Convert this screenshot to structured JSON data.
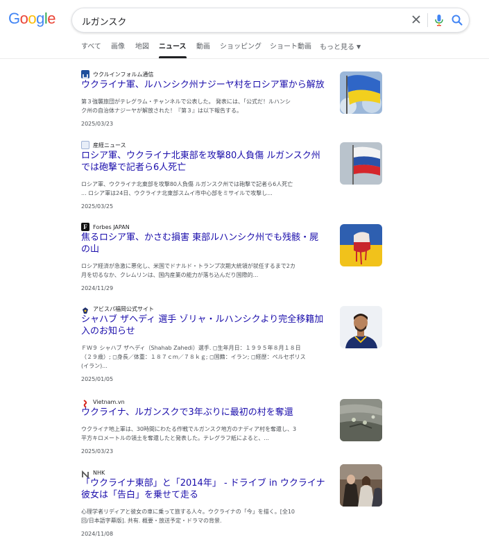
{
  "logo": {
    "text": "Google"
  },
  "search": {
    "query": "ルガンスク"
  },
  "tabs": [
    {
      "label": "すべて"
    },
    {
      "label": "画像"
    },
    {
      "label": "地図"
    },
    {
      "label": "ニュース"
    },
    {
      "label": "動画"
    },
    {
      "label": "ショッピング"
    },
    {
      "label": "ショート動画"
    },
    {
      "label": "もっと見る"
    }
  ],
  "results": [
    {
      "source": "ウクルインフォルム通信",
      "title_line1": "ウクライナ軍、ルハンシク州ナジーヤ村をロシア軍から解放",
      "title_line2": "",
      "snippet_line1": "第３強襲旅団がテレグラム・チャンネルで公表した。 発表には、「公式だ！ルハンシ",
      "snippet_line2": "ク州の自治体ナジーヤが解放された！『第３』は以下報告する。",
      "snippet_line3": "",
      "date": "2025/03/23"
    },
    {
      "source": "産経ニュース",
      "title_line1": "ロシア軍、ウクライナ北東部を攻撃80人負傷 ルガンスク州",
      "title_line2": "では砲撃で記者ら6人死亡",
      "snippet_line1": "ロシア軍、ウクライナ北東部を攻撃80人負傷 ルガンスク州では砲撃で記者ら6人死亡",
      "snippet_line2": "... ロシア軍は24日、ウクライナ北東部スムイ市中心部をミサイルで攻撃し...",
      "snippet_line3": "",
      "date": "2025/03/25"
    },
    {
      "source": "Forbes JAPAN",
      "title_line1": "焦るロシア軍、かさむ損害 東部ルハンシク州でも残骸・屍",
      "title_line2": "の山",
      "snippet_line1": "ロシア経済が急激に悪化し、米国でドナルド・トランプ次期大統領が就任するまで2カ",
      "snippet_line2": "月を切るなか、クレムリンは、国内産業の能力が落ち込んだり国際的...",
      "snippet_line3": "",
      "date": "2024/11/29"
    },
    {
      "source": "アビスパ福岡公式サイト",
      "title_line1": "シャハブ ザヘディ 選手 ゾリャ・ルハンシクより完全移籍加",
      "title_line2": "入のお知らせ",
      "snippet_line1": "ＦＷ９ シャハブ ザヘディ（Shahab Zahedi）選手. ◻生年月日：１９９５年８月１８日",
      "snippet_line2": "（２９歳）; ◻身長／体重：１８７ｃｍ／７８ｋｇ; ◻国籍：イラン; ◻経歴：ペルセポリス",
      "snippet_line3": "(イラン)...",
      "date": "2025/01/05"
    },
    {
      "source": "Vietnam.vn",
      "title_line1": "ウクライナ、ルガンスクで3年ぶりに最初の村を奪還",
      "title_line2": "",
      "snippet_line1": "ウクライナ地上軍は、30時間にわたる作戦でルガンスク地方のナディア村を奪還し、3",
      "snippet_line2": "平方キロメートルの領土を奪還したと発表した。テレグラフ紙によると、...",
      "snippet_line3": "",
      "date": "2025/03/23"
    },
    {
      "source": "NHK",
      "title_line1": "「ウクライナ東部」と「2014年」 - ドライブ in ウクライナ",
      "title_line2": "彼女は「告白」を乗せて走る",
      "snippet_line1": "心理学者リディアと彼女の車に乗って旅する人々。ウクライナの「今」を描く。[全10",
      "snippet_line2": "回/日本語字幕版]. 共有. 概要・放送予定・ドラマの背景.",
      "snippet_line3": "",
      "date": "2024/11/08"
    }
  ],
  "colors": {
    "link": "#1a0dab",
    "snippet": "#4d5156",
    "google_blue": "#4285f4",
    "google_red": "#ea4335",
    "google_yellow": "#fbbc05",
    "google_green": "#34a853"
  }
}
